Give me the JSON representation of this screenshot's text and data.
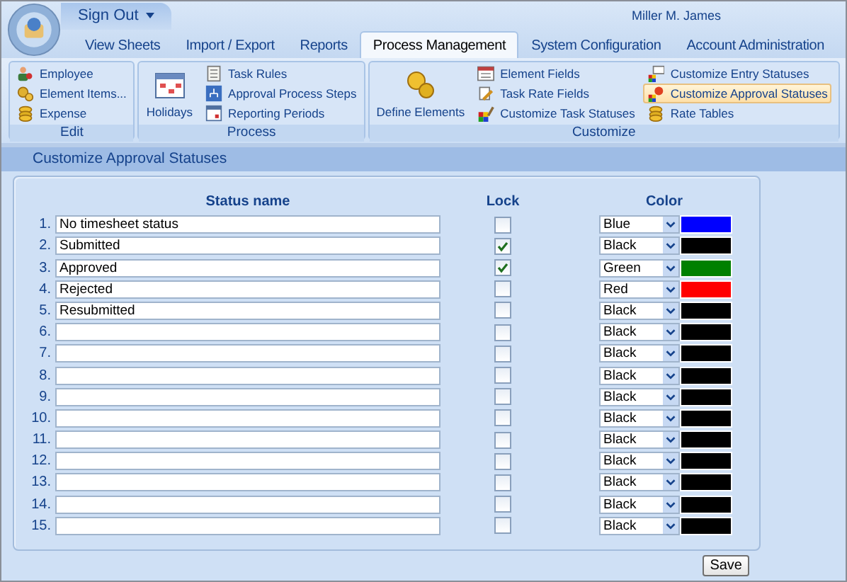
{
  "menu": {
    "label": "Sign Out"
  },
  "user": "Miller M. James",
  "tabs": [
    {
      "label": "View Sheets",
      "selected": false
    },
    {
      "label": "Import / Export",
      "selected": false
    },
    {
      "label": "Reports",
      "selected": false
    },
    {
      "label": "Process Management",
      "selected": true
    },
    {
      "label": "System Configuration",
      "selected": false
    },
    {
      "label": "Account Administration",
      "selected": false
    }
  ],
  "ribbon": {
    "groups": [
      {
        "label": "Edit",
        "columns": [
          [
            {
              "label": "Employee",
              "selected": false
            },
            {
              "label": "Element Items...",
              "selected": false
            },
            {
              "label": "Expense",
              "selected": false
            }
          ]
        ]
      },
      {
        "label": "Process",
        "large": {
          "label": "Holidays",
          "selected": false
        },
        "columns": [
          [
            {
              "label": "Task Rules",
              "selected": false
            },
            {
              "label": "Approval Process Steps",
              "selected": false
            },
            {
              "label": "Reporting Periods",
              "selected": false
            }
          ]
        ]
      },
      {
        "label": "Customize",
        "large": {
          "label": "Define Elements",
          "selected": false
        },
        "columns": [
          [
            {
              "label": "Element Fields",
              "selected": false
            },
            {
              "label": "Task Rate Fields",
              "selected": false
            },
            {
              "label": "Customize Task Statuses",
              "selected": false
            }
          ],
          [
            {
              "label": "Customize Entry Statuses",
              "selected": false
            },
            {
              "label": "Customize Approval Statuses",
              "selected": true
            },
            {
              "label": "Rate Tables",
              "selected": false
            }
          ]
        ]
      }
    ]
  },
  "section_title": "Customize Approval Statuses",
  "table": {
    "columns": [
      "Status name",
      "Lock",
      "Color"
    ],
    "rows": [
      {
        "number": "1.",
        "name": "No timesheet status",
        "checked": false,
        "color_name": "Blue",
        "color": "#0000ff"
      },
      {
        "number": "2.",
        "name": "Submitted",
        "checked": true,
        "color_name": "Black",
        "color": "#000000"
      },
      {
        "number": "3.",
        "name": "Approved",
        "checked": true,
        "color_name": "Green",
        "color": "#008000"
      },
      {
        "number": "4.",
        "name": "Rejected",
        "checked": false,
        "color_name": "Red",
        "color": "#ff0000"
      },
      {
        "number": "5.",
        "name": "Resubmitted",
        "checked": false,
        "color_name": "Black",
        "color": "#000000"
      },
      {
        "number": "6.",
        "checked": false,
        "color_name": "Black",
        "color": "#000000"
      },
      {
        "number": "7.",
        "checked": false,
        "color_name": "Black",
        "color": "#000000"
      },
      {
        "number": "8.",
        "checked": false,
        "color_name": "Black",
        "color": "#000000"
      },
      {
        "number": "9.",
        "checked": false,
        "color_name": "Black",
        "color": "#000000"
      },
      {
        "number": "10.",
        "checked": false,
        "color_name": "Black",
        "color": "#000000"
      },
      {
        "number": "11.",
        "checked": false,
        "color_name": "Black",
        "color": "#000000"
      },
      {
        "number": "12.",
        "checked": false,
        "color_name": "Black",
        "color": "#000000"
      },
      {
        "number": "13.",
        "checked": false,
        "color_name": "Black",
        "color": "#000000"
      },
      {
        "number": "14.",
        "checked": false,
        "color_name": "Black",
        "color": "#000000"
      },
      {
        "number": "15.",
        "checked": false,
        "color_name": "Black",
        "color": "#000000"
      }
    ]
  },
  "save": "Save"
}
